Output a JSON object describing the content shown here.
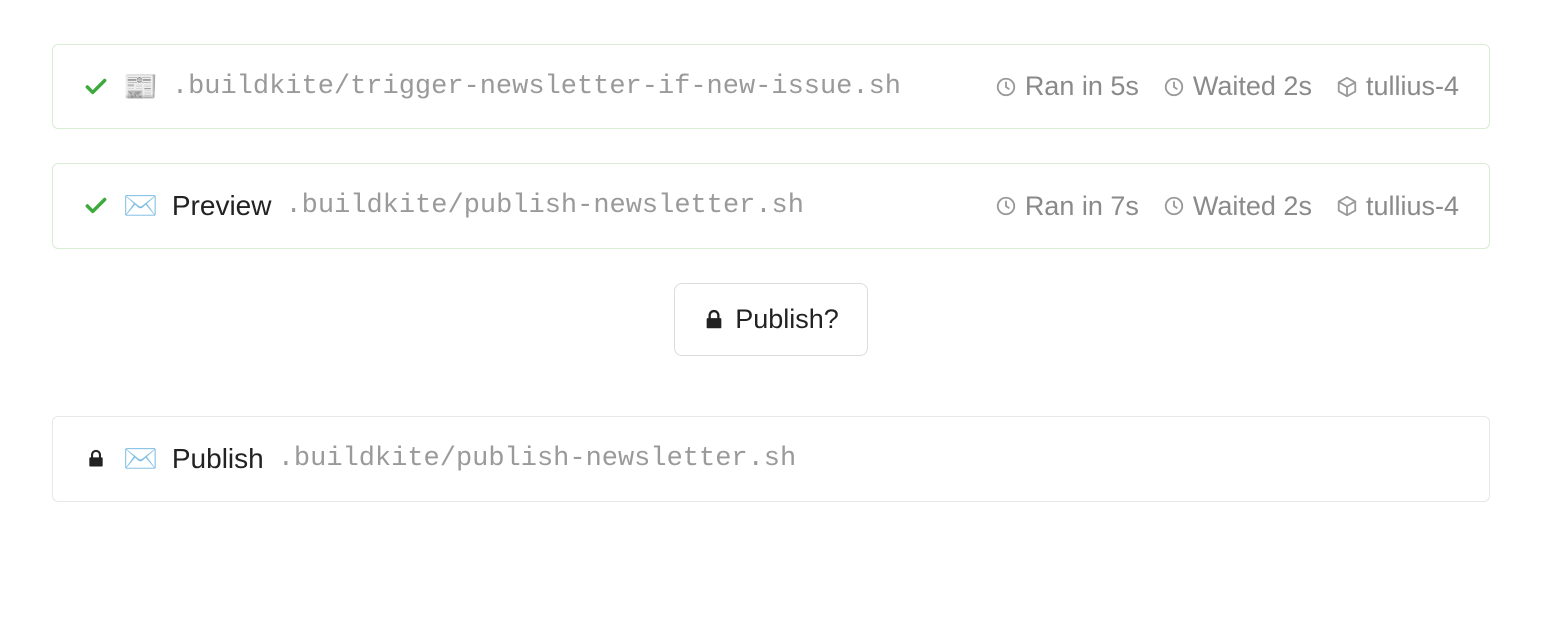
{
  "steps": [
    {
      "status": "passed",
      "emoji": "📰",
      "emoji_name": "newspaper-icon",
      "label": "",
      "command": ".buildkite/trigger-newsletter-if-new-issue.sh",
      "ran_in": "Ran in 5s",
      "waited": "Waited 2s",
      "agent": "tullius-4"
    },
    {
      "status": "passed",
      "emoji": "✉️",
      "emoji_name": "envelope-icon",
      "label": "Preview",
      "command": ".buildkite/publish-newsletter.sh",
      "ran_in": "Ran in 7s",
      "waited": "Waited 2s",
      "agent": "tullius-4"
    }
  ],
  "block": {
    "label": "Publish?"
  },
  "locked_step": {
    "emoji": "✉️",
    "emoji_name": "envelope-icon",
    "label": "Publish",
    "command": ".buildkite/publish-newsletter.sh"
  }
}
